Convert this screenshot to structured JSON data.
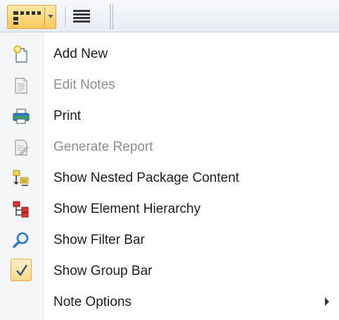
{
  "toolbar": {
    "buttons": [
      {
        "name": "grid-view",
        "icon": "grid-dots-icon",
        "has_dropdown": true,
        "state": "active"
      },
      {
        "name": "list-view",
        "icon": "list-lines-icon",
        "has_dropdown": false,
        "state": "normal"
      }
    ]
  },
  "menu": {
    "items": [
      {
        "label": "Add New",
        "icon": "add-new-document-icon",
        "enabled": true
      },
      {
        "label": "Edit Notes",
        "icon": "edit-notes-icon",
        "enabled": false
      },
      {
        "label": "Print",
        "icon": "printer-icon",
        "enabled": true
      },
      {
        "label": "Generate Report",
        "icon": "generate-report-icon",
        "enabled": false
      },
      {
        "label": "Show Nested Package Content",
        "icon": "nested-package-icon",
        "enabled": true
      },
      {
        "label": "Show Element Hierarchy",
        "icon": "element-hierarchy-icon",
        "enabled": true
      },
      {
        "label": "Show Filter Bar",
        "icon": "magnifier-icon",
        "enabled": true
      },
      {
        "label": "Show Group Bar",
        "icon": "checkmark-icon",
        "enabled": true,
        "checked": true
      },
      {
        "label": "Note Options",
        "icon": "",
        "enabled": true,
        "submenu": true
      }
    ]
  },
  "colors": {
    "accent_highlight": "#f8c75c",
    "accent_border": "#e3a33f",
    "disabled_text": "#8d8d8d",
    "text": "#1e1e1e"
  }
}
